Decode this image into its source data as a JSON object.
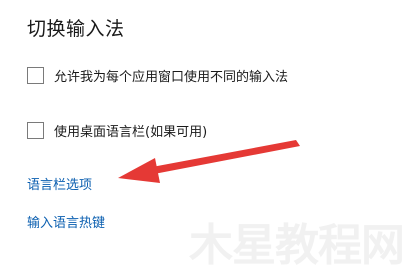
{
  "section": {
    "title": "切换输入法"
  },
  "options": [
    {
      "label": "允许我为每个应用窗口使用不同的输入法",
      "checked": false
    },
    {
      "label": "使用桌面语言栏(如果可用)",
      "checked": false
    }
  ],
  "links": {
    "language_bar_options": "语言栏选项",
    "input_language_hotkeys": "输入语言热键"
  },
  "annotation": {
    "arrow_color": "#e53935"
  },
  "watermark": {
    "text": "木星教程网"
  }
}
